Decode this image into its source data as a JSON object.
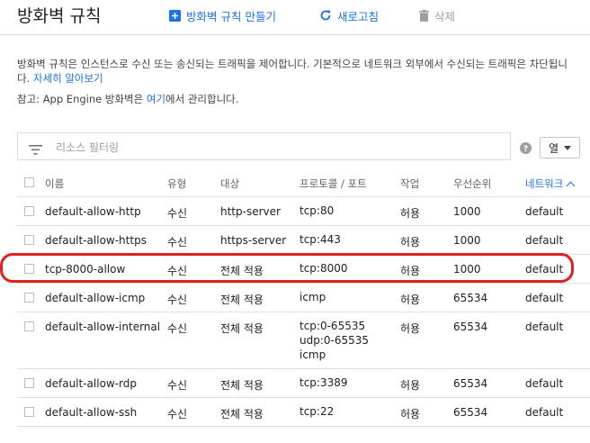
{
  "header": {
    "title": "방화벽 규칙",
    "create_label": "방화벽 규칙 만들기",
    "refresh_label": "새로고침",
    "delete_label": "삭제"
  },
  "description": {
    "text": "방화벽 규칙은 인스턴스로 수신 또는 송신되는 트래픽을 제어합니다. 기본적으로 네트워크 외부에서 수신되는 트래픽은 차단됩니다.",
    "learn_more": "자세히 알아보기"
  },
  "note": {
    "prefix": "참고: App Engine 방화벽은",
    "link": "여기",
    "suffix": "에서 관리합니다."
  },
  "filter": {
    "placeholder": "리소스 필터링",
    "columns_label": "열"
  },
  "table": {
    "headers": {
      "name": "이름",
      "type": "유형",
      "target": "대상",
      "protocol": "프로토콜 / 포트",
      "action": "작업",
      "priority": "우선순위",
      "network": "네트워크"
    },
    "rows": [
      {
        "name": "default-allow-http",
        "type": "수신",
        "target": "http-server",
        "protocol": "tcp:80",
        "action": "허용",
        "priority": "1000",
        "network": "default"
      },
      {
        "name": "default-allow-https",
        "type": "수신",
        "target": "https-server",
        "protocol": "tcp:443",
        "action": "허용",
        "priority": "1000",
        "network": "default"
      },
      {
        "name": "tcp-8000-allow",
        "type": "수신",
        "target": "전체 적용",
        "protocol": "tcp:8000",
        "action": "허용",
        "priority": "1000",
        "network": "default"
      },
      {
        "name": "default-allow-icmp",
        "type": "수신",
        "target": "전체 적용",
        "protocol": "icmp",
        "action": "허용",
        "priority": "65534",
        "network": "default"
      },
      {
        "name": "default-allow-internal",
        "type": "수신",
        "target": "전체 적용",
        "protocol_lines": [
          "tcp:0-65535",
          "udp:0-65535",
          "icmp"
        ],
        "action": "허용",
        "priority": "65534",
        "network": "default"
      },
      {
        "name": "default-allow-rdp",
        "type": "수신",
        "target": "전체 적용",
        "protocol": "tcp:3389",
        "action": "허용",
        "priority": "65534",
        "network": "default"
      },
      {
        "name": "default-allow-ssh",
        "type": "수신",
        "target": "전체 적용",
        "protocol": "tcp:22",
        "action": "허용",
        "priority": "65534",
        "network": "default"
      }
    ]
  },
  "colors": {
    "accent": "#1a73e8",
    "highlight": "#e0201c"
  }
}
